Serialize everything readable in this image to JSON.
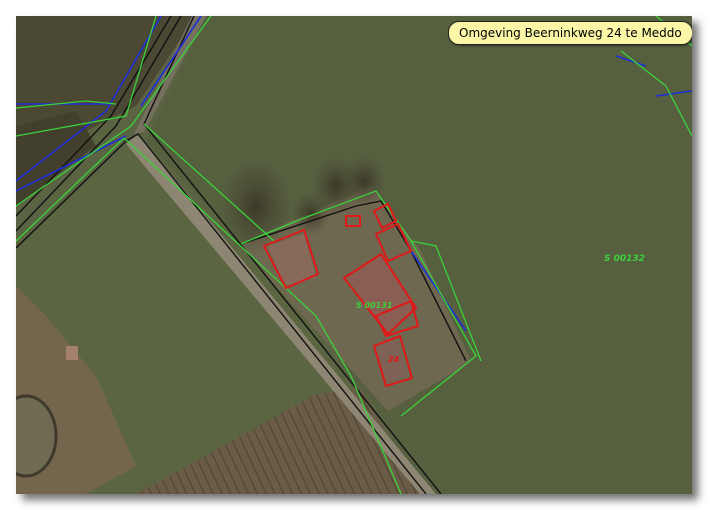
{
  "map": {
    "title": "Omgeving Beerninkweg 24 te Meddo",
    "parcel_labels": [
      {
        "id": "parcel-s00132",
        "text": "S 00132"
      },
      {
        "id": "parcel-s00131",
        "text": "S 00131"
      },
      {
        "id": "house-number",
        "text": "24"
      }
    ],
    "colors": {
      "parcel_boundary": "#3ad23a",
      "building_outline": "#e01818",
      "water_line": "#1e2fd8",
      "road_edge": "#111111",
      "title_background": "#fbf7a6"
    },
    "layers": [
      "aerial-photo",
      "parcel-boundaries",
      "building-outlines",
      "waterways",
      "road-edges"
    ]
  }
}
